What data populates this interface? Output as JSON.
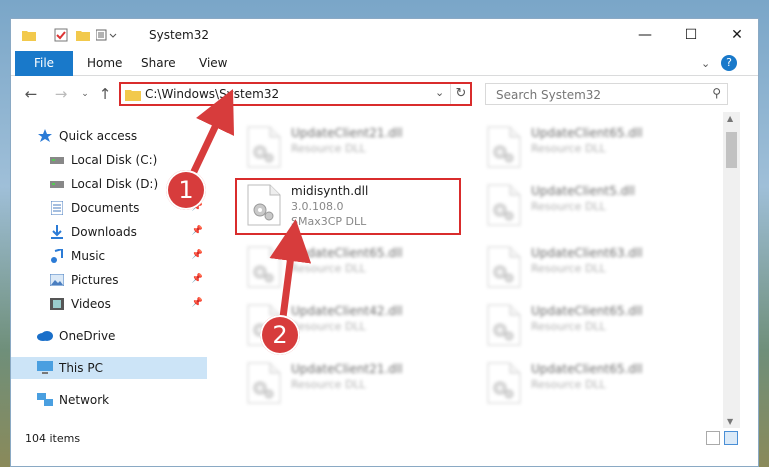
{
  "window": {
    "title": "System32",
    "controls": {
      "minimize": "—",
      "maximize": "☐",
      "close": "✕"
    }
  },
  "ribbon": {
    "tabs": [
      {
        "label": "File",
        "active": true
      },
      {
        "label": "Home"
      },
      {
        "label": "Share"
      },
      {
        "label": "View"
      }
    ]
  },
  "address": {
    "path": "C:\\Windows\\System32"
  },
  "search": {
    "placeholder": "Search System32"
  },
  "nav": {
    "items": [
      {
        "label": "Quick access",
        "icon": "star-icon",
        "pinned": false
      },
      {
        "label": "Local Disk (C:)",
        "icon": "drive-icon",
        "pinned": false
      },
      {
        "label": "Local Disk (D:)",
        "icon": "drive-icon",
        "pinned": false
      },
      {
        "label": "Documents",
        "icon": "documents-icon",
        "pinned": true
      },
      {
        "label": "Downloads",
        "icon": "downloads-icon",
        "pinned": true
      },
      {
        "label": "Music",
        "icon": "music-icon",
        "pinned": true
      },
      {
        "label": "Pictures",
        "icon": "pictures-icon",
        "pinned": true
      },
      {
        "label": "Videos",
        "icon": "videos-icon",
        "pinned": true
      },
      {
        "label": "OneDrive",
        "icon": "cloud-icon",
        "pinned": false
      },
      {
        "label": "This PC",
        "icon": "pc-icon",
        "pinned": false,
        "selected": true
      },
      {
        "label": "Network",
        "icon": "network-icon",
        "pinned": false
      }
    ]
  },
  "files": [
    {
      "name": "UpdateClient21.dll",
      "type": "Resource DLL",
      "blurred": true
    },
    {
      "name": "UpdateClient65.dll",
      "type": "Resource DLL",
      "blurred": true
    },
    {
      "name": "midisynth.dll",
      "version": "3.0.108.0",
      "type": "SMax3CP DLL",
      "blurred": false,
      "highlighted": true
    },
    {
      "name": "UpdateClient5.dll",
      "type": "Resource DLL",
      "blurred": true
    },
    {
      "name": "UpdateClient65.dll",
      "type": "Resource DLL",
      "blurred": true
    },
    {
      "name": "UpdateClient63.dll",
      "type": "Resource DLL",
      "blurred": true
    },
    {
      "name": "UpdateClient42.dll",
      "type": "Resource DLL",
      "blurred": true
    },
    {
      "name": "UpdateClient65.dll",
      "type": "Resource DLL",
      "blurred": true
    },
    {
      "name": "UpdateClient21.dll",
      "type": "Resource DLL",
      "blurred": true
    },
    {
      "name": "UpdateClient65.dll",
      "type": "Resource DLL",
      "blurred": true
    }
  ],
  "status": {
    "item_count": "104 items"
  },
  "annotations": {
    "step1": "1",
    "step2": "2",
    "color": "#d73c3c"
  }
}
